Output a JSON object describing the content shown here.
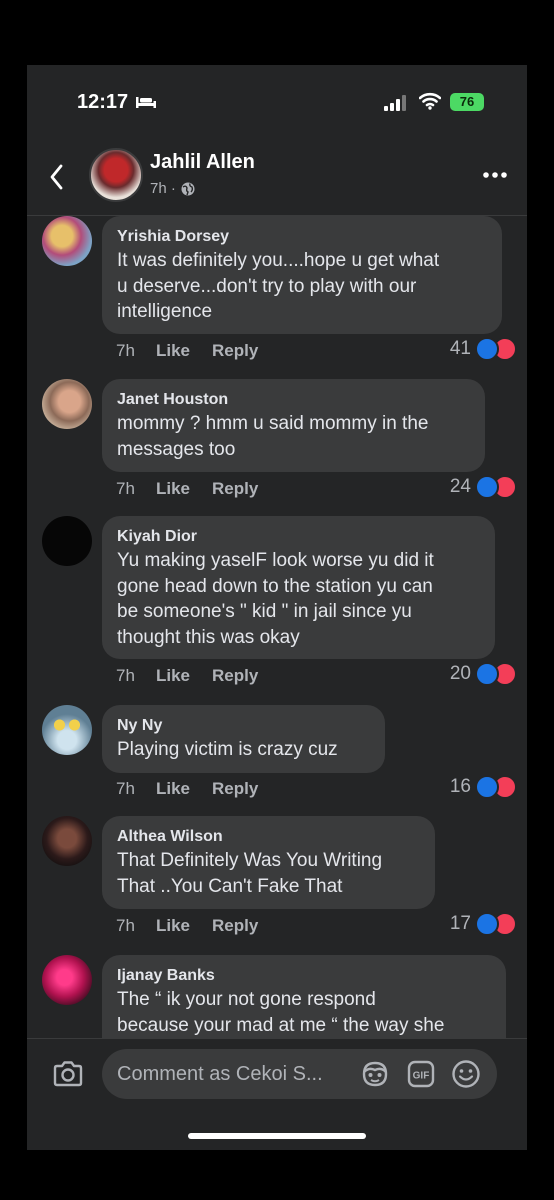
{
  "status_bar": {
    "time": "12:17",
    "battery": "76"
  },
  "header": {
    "name": "Jahlil Allen",
    "time": "7h ·"
  },
  "comments": [
    {
      "name": "Yrishia Dorsey",
      "lines": [
        "It was definitely you....hope u get what",
        "u deserve...don't try to play with our",
        "intelligence"
      ],
      "time": "7h",
      "like": "Like",
      "reply": "Reply",
      "reactions": "41"
    },
    {
      "name": "Janet Houston",
      "lines": [
        "mommy ? hmm u said mommy in the",
        "messages too"
      ],
      "time": "7h",
      "like": "Like",
      "reply": "Reply",
      "reactions": "24"
    },
    {
      "name": "Kiyah Dior",
      "lines": [
        "Yu making yaselF look worse yu did it",
        "gone head down to the station yu can",
        "be someone's \" kid \" in jail since yu",
        "thought this was okay"
      ],
      "time": "7h",
      "like": "Like",
      "reply": "Reply",
      "reactions": "20"
    },
    {
      "name": "Ny Ny",
      "lines": [
        "Playing victim is crazy cuz"
      ],
      "time": "7h",
      "like": "Like",
      "reply": "Reply",
      "reactions": "16"
    },
    {
      "name": "Althea Wilson",
      "lines": [
        "That Definitely Was You Writing",
        "That ..You Can't Fake That"
      ],
      "time": "7h",
      "like": "Like",
      "reply": "Reply",
      "reactions": "17"
    },
    {
      "name": "Ijanay Banks",
      "lines": [
        "The “ ik your not gone respond",
        "because your mad at me “ the way she"
      ]
    }
  ],
  "footer": {
    "placeholder": "Comment as Cekoi S..."
  },
  "colors": {
    "background": "#242526",
    "bubble": "#3a3b3c",
    "like_blue": "#1b74e4",
    "love_red": "#f33e58",
    "battery_green": "#4cd964"
  },
  "icons": [
    "bed-icon",
    "signal-icon",
    "wifi-icon",
    "back-icon",
    "globe-icon",
    "more-icon",
    "camera-icon",
    "avatar-sticker-icon",
    "gif-icon",
    "emoji-icon"
  ]
}
